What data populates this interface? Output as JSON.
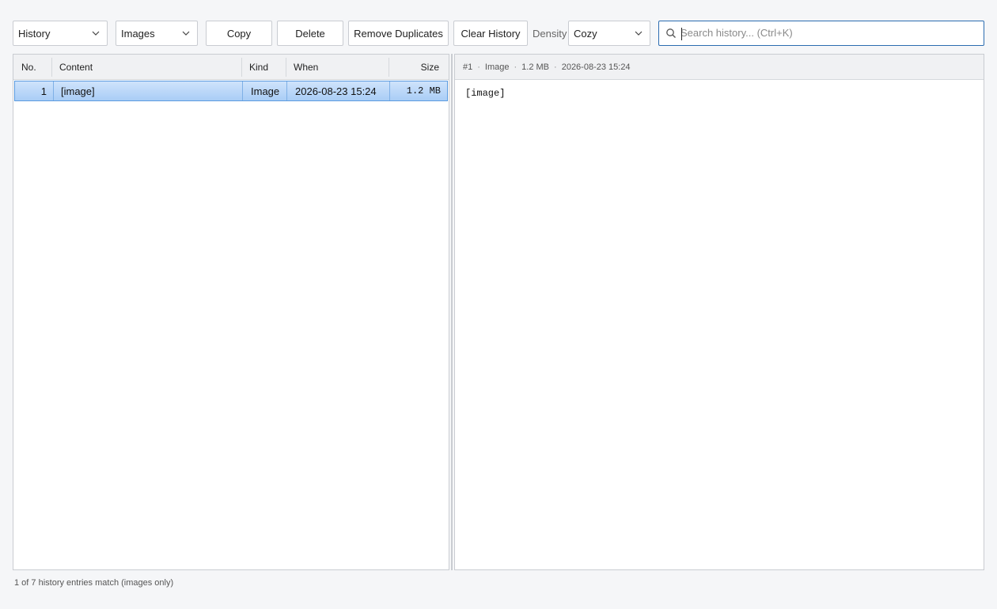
{
  "toolbar": {
    "source_select": "History",
    "filter_select": "Images",
    "copy_label": "Copy",
    "delete_label": "Delete",
    "remove_duplicates_label": "Remove Duplicates",
    "clear_history_label": "Clear History",
    "density_label": "Density",
    "density_select": "Cozy"
  },
  "search": {
    "placeholder": "Search history...  (Ctrl+K)",
    "value": ""
  },
  "list": {
    "columns": [
      "No.",
      "Content",
      "Kind",
      "When",
      "Size"
    ],
    "rows": [
      {
        "no": "1",
        "content": "[image]",
        "kind": "Image",
        "when": "2026-08-23 15:24",
        "size": "1.2 MB",
        "selected": true
      }
    ]
  },
  "detail": {
    "header": {
      "index": "#1",
      "kind": "Image",
      "size": "1.2 MB",
      "when": "2026-08-23 15:24"
    },
    "body": "[image]"
  },
  "status": "1 of 7 history entries match (images only)",
  "colors": {
    "accent": "#2b6cb0",
    "selection": "#a9cdf6"
  }
}
